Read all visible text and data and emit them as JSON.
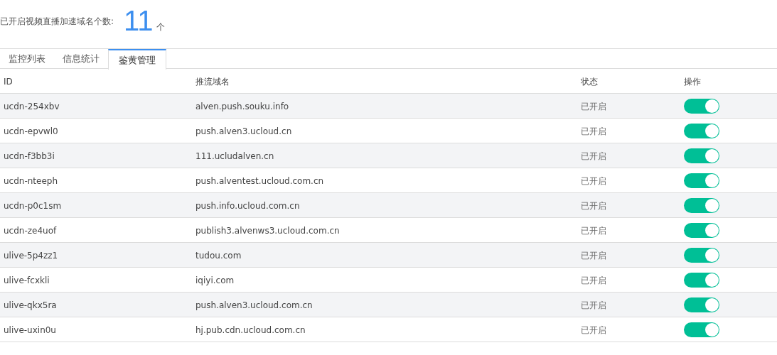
{
  "summary": {
    "label": "已开启视频直播加速域名个数:",
    "count": "11",
    "unit": "个"
  },
  "tabs": [
    {
      "label": "监控列表",
      "selected": false
    },
    {
      "label": "信息统计",
      "selected": false
    },
    {
      "label": "鉴黄管理",
      "selected": true
    }
  ],
  "table": {
    "columns": [
      "ID",
      "推流域名",
      "状态",
      "操作"
    ],
    "rows": [
      {
        "id": "ucdn-254xbv",
        "domain": "alven.push.souku.info",
        "status": "已开启",
        "on": true
      },
      {
        "id": "ucdn-epvwl0",
        "domain": "push.alven3.ucloud.cn",
        "status": "已开启",
        "on": true
      },
      {
        "id": "ucdn-f3bb3i",
        "domain": "111.ucludalven.cn",
        "status": "已开启",
        "on": true
      },
      {
        "id": "ucdn-nteeph",
        "domain": "push.alventest.ucloud.com.cn",
        "status": "已开启",
        "on": true
      },
      {
        "id": "ucdn-p0c1sm",
        "domain": "push.info.ucloud.com.cn",
        "status": "已开启",
        "on": true
      },
      {
        "id": "ucdn-ze4uof",
        "domain": "publish3.alvenws3.ucloud.com.cn",
        "status": "已开启",
        "on": true
      },
      {
        "id": "ulive-5p4zz1",
        "domain": "tudou.com",
        "status": "已开启",
        "on": true
      },
      {
        "id": "ulive-fcxkli",
        "domain": "iqiyi.com",
        "status": "已开启",
        "on": true
      },
      {
        "id": "ulive-qkx5ra",
        "domain": "push.alven3.ucloud.com.cn",
        "status": "已开启",
        "on": true
      },
      {
        "id": "ulive-uxin0u",
        "domain": "hj.pub.cdn.ucloud.com.cn",
        "status": "已开启",
        "on": true
      }
    ]
  }
}
